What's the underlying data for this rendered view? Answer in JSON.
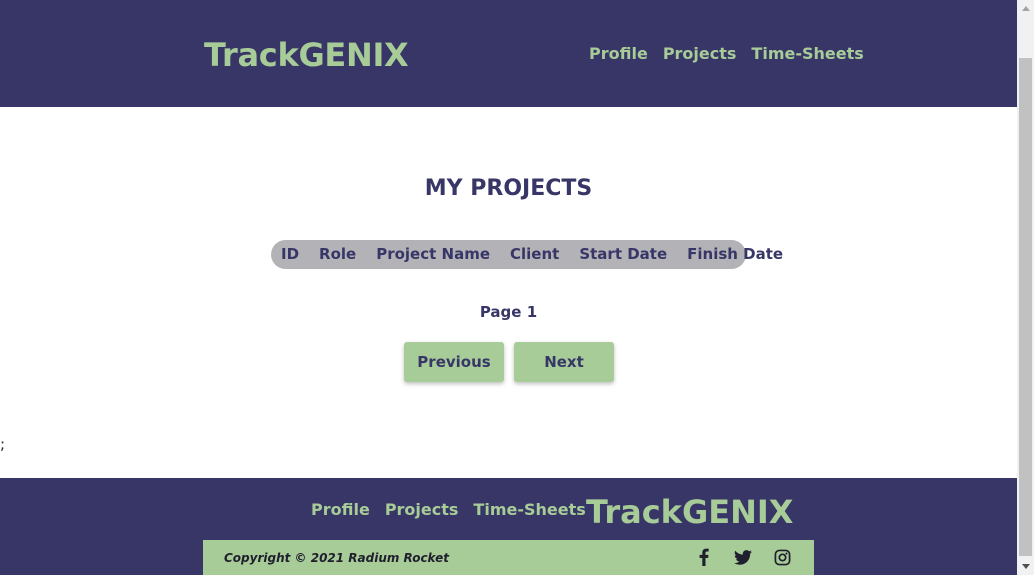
{
  "header": {
    "logo": "TrackGENIX",
    "nav": [
      "Profile",
      "Projects",
      "Time-Sheets"
    ]
  },
  "main": {
    "title": "MY PROJECTS",
    "table": {
      "columns": [
        "ID",
        "Role",
        "Project Name",
        "Client",
        "Start Date",
        "Finish Date"
      ],
      "rows": []
    },
    "page_label": "Page 1",
    "previous_label": "Previous",
    "next_label": "Next",
    "stray_text": ";"
  },
  "footer": {
    "nav": [
      "Profile",
      "Projects",
      "Time-Sheets"
    ],
    "logo": "TrackGENIX",
    "copyright": "Copyright © 2021 Radium Rocket",
    "social": [
      "facebook-icon",
      "twitter-icon",
      "instagram-icon"
    ]
  },
  "colors": {
    "primary": "#373667",
    "accent": "#a8cc98",
    "table_header_bg": "#b3b3b7",
    "background": "#ffffff"
  }
}
